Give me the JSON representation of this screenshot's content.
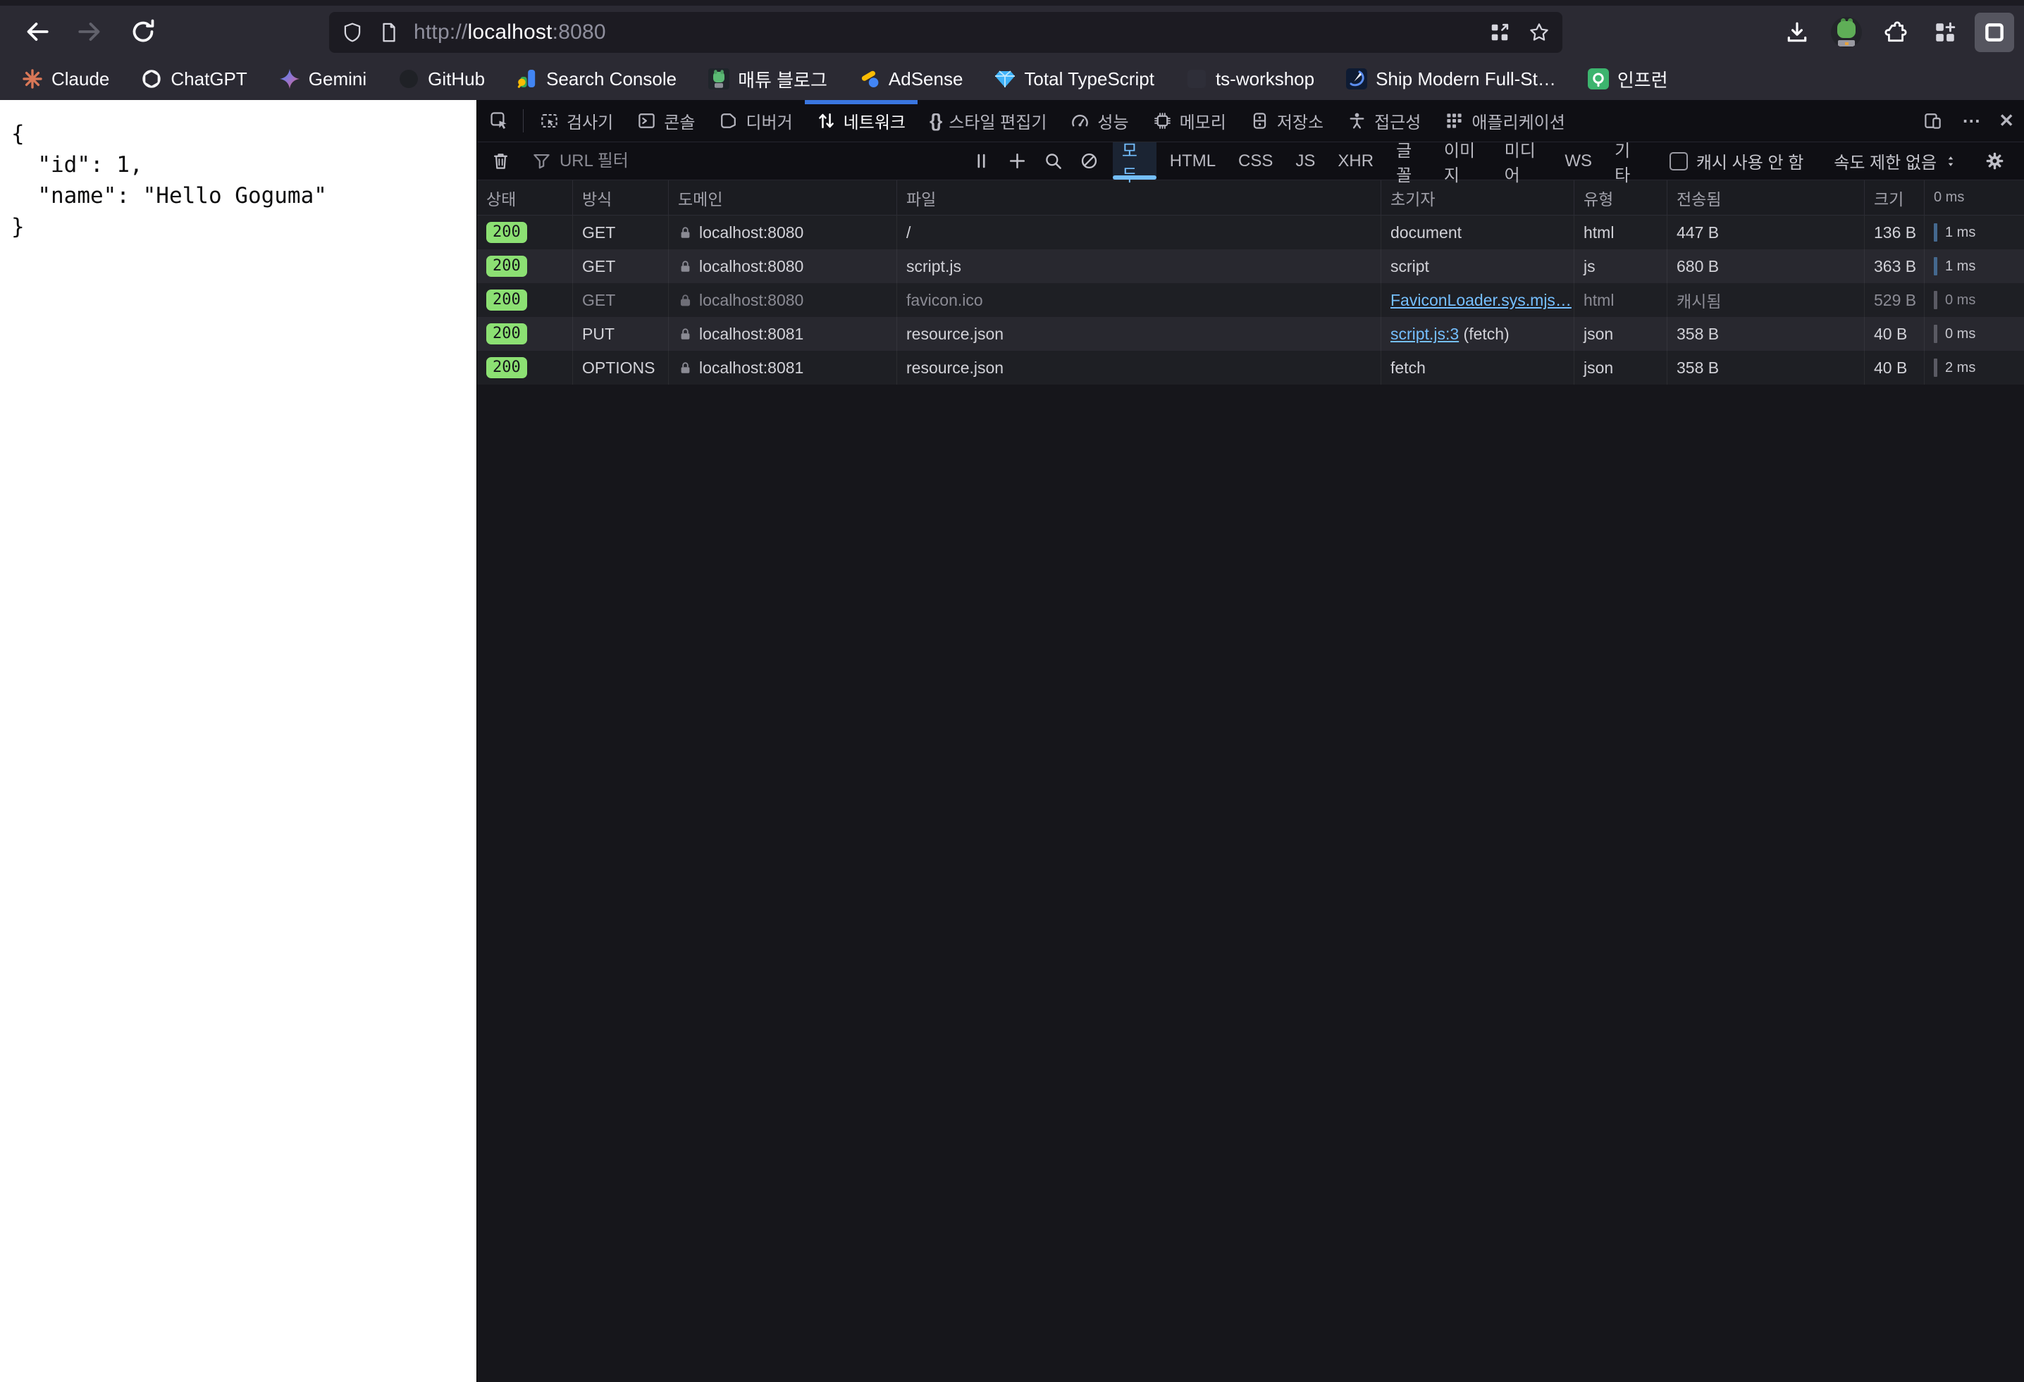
{
  "colors": {
    "accent_tab_blue": "#3a76e0",
    "filter_active_blue": "#75bfff",
    "link_blue": "#75bfff",
    "status_badge_green": "#8ce073"
  },
  "icons": {
    "more": "⋯",
    "close": "✕",
    "braces": "{}",
    "pause": "‖",
    "updown": "⇕"
  },
  "browser": {
    "url": {
      "scheme": "http://",
      "host": "localhost",
      "port": ":8080"
    },
    "bookmarks": [
      {
        "label": "Claude"
      },
      {
        "label": "ChatGPT"
      },
      {
        "label": "Gemini"
      },
      {
        "label": "GitHub"
      },
      {
        "label": "Search Console"
      },
      {
        "label": "매튜 블로그"
      },
      {
        "label": "AdSense"
      },
      {
        "label": "Total TypeScript"
      },
      {
        "label": "ts-workshop"
      },
      {
        "label": "Ship Modern Full-St…"
      },
      {
        "label": "인프런"
      }
    ]
  },
  "page": {
    "json_text": "{\n  \"id\": 1,\n  \"name\": \"Hello Goguma\"\n}"
  },
  "devtools": {
    "tabs": [
      {
        "label": "검사기"
      },
      {
        "label": "콘솔"
      },
      {
        "label": "디버거"
      },
      {
        "label": "네트워크"
      },
      {
        "label": "스타일 편집기"
      },
      {
        "label": "성능"
      },
      {
        "label": "메모리"
      },
      {
        "label": "저장소"
      },
      {
        "label": "접근성"
      },
      {
        "label": "애플리케이션"
      }
    ],
    "network": {
      "filter_placeholder": "URL 필터",
      "filters": [
        "모두",
        "HTML",
        "CSS",
        "JS",
        "XHR",
        "글꼴",
        "이미지",
        "미디어",
        "WS",
        "기타"
      ],
      "cache_checkbox_label": "캐시 사용 안 함",
      "throttle_label": "속도 제한 없음",
      "columns": {
        "status": "상태",
        "method": "방식",
        "domain": "도메인",
        "file": "파일",
        "initiator": "초기자",
        "type": "유형",
        "transferred": "전송됨",
        "size": "크기",
        "timing": "0 ms"
      },
      "requests": [
        {
          "status": "200",
          "method": "GET",
          "domain": "localhost:8080",
          "file": "/",
          "initiator": "document",
          "type": "html",
          "transferred": "447 B",
          "size": "136 B",
          "time": "1 ms"
        },
        {
          "status": "200",
          "method": "GET",
          "domain": "localhost:8080",
          "file": "script.js",
          "initiator": "script",
          "type": "js",
          "transferred": "680 B",
          "size": "363 B",
          "time": "1 ms"
        },
        {
          "status": "200",
          "method": "GET",
          "domain": "localhost:8080",
          "file": "favicon.ico",
          "initiator": "FaviconLoader.sys.mjs…",
          "type": "html",
          "transferred": "캐시됨",
          "size": "529 B",
          "time": "0 ms"
        },
        {
          "status": "200",
          "method": "PUT",
          "domain": "localhost:8081",
          "file": "resource.json",
          "initiator": "script.js:3",
          "initiator_suffix": " (fetch)",
          "type": "json",
          "transferred": "358 B",
          "size": "40 B",
          "time": "0 ms"
        },
        {
          "status": "200",
          "method": "OPTIONS",
          "domain": "localhost:8081",
          "file": "resource.json",
          "initiator": "fetch",
          "type": "json",
          "transferred": "358 B",
          "size": "40 B",
          "time": "2 ms"
        }
      ]
    }
  }
}
